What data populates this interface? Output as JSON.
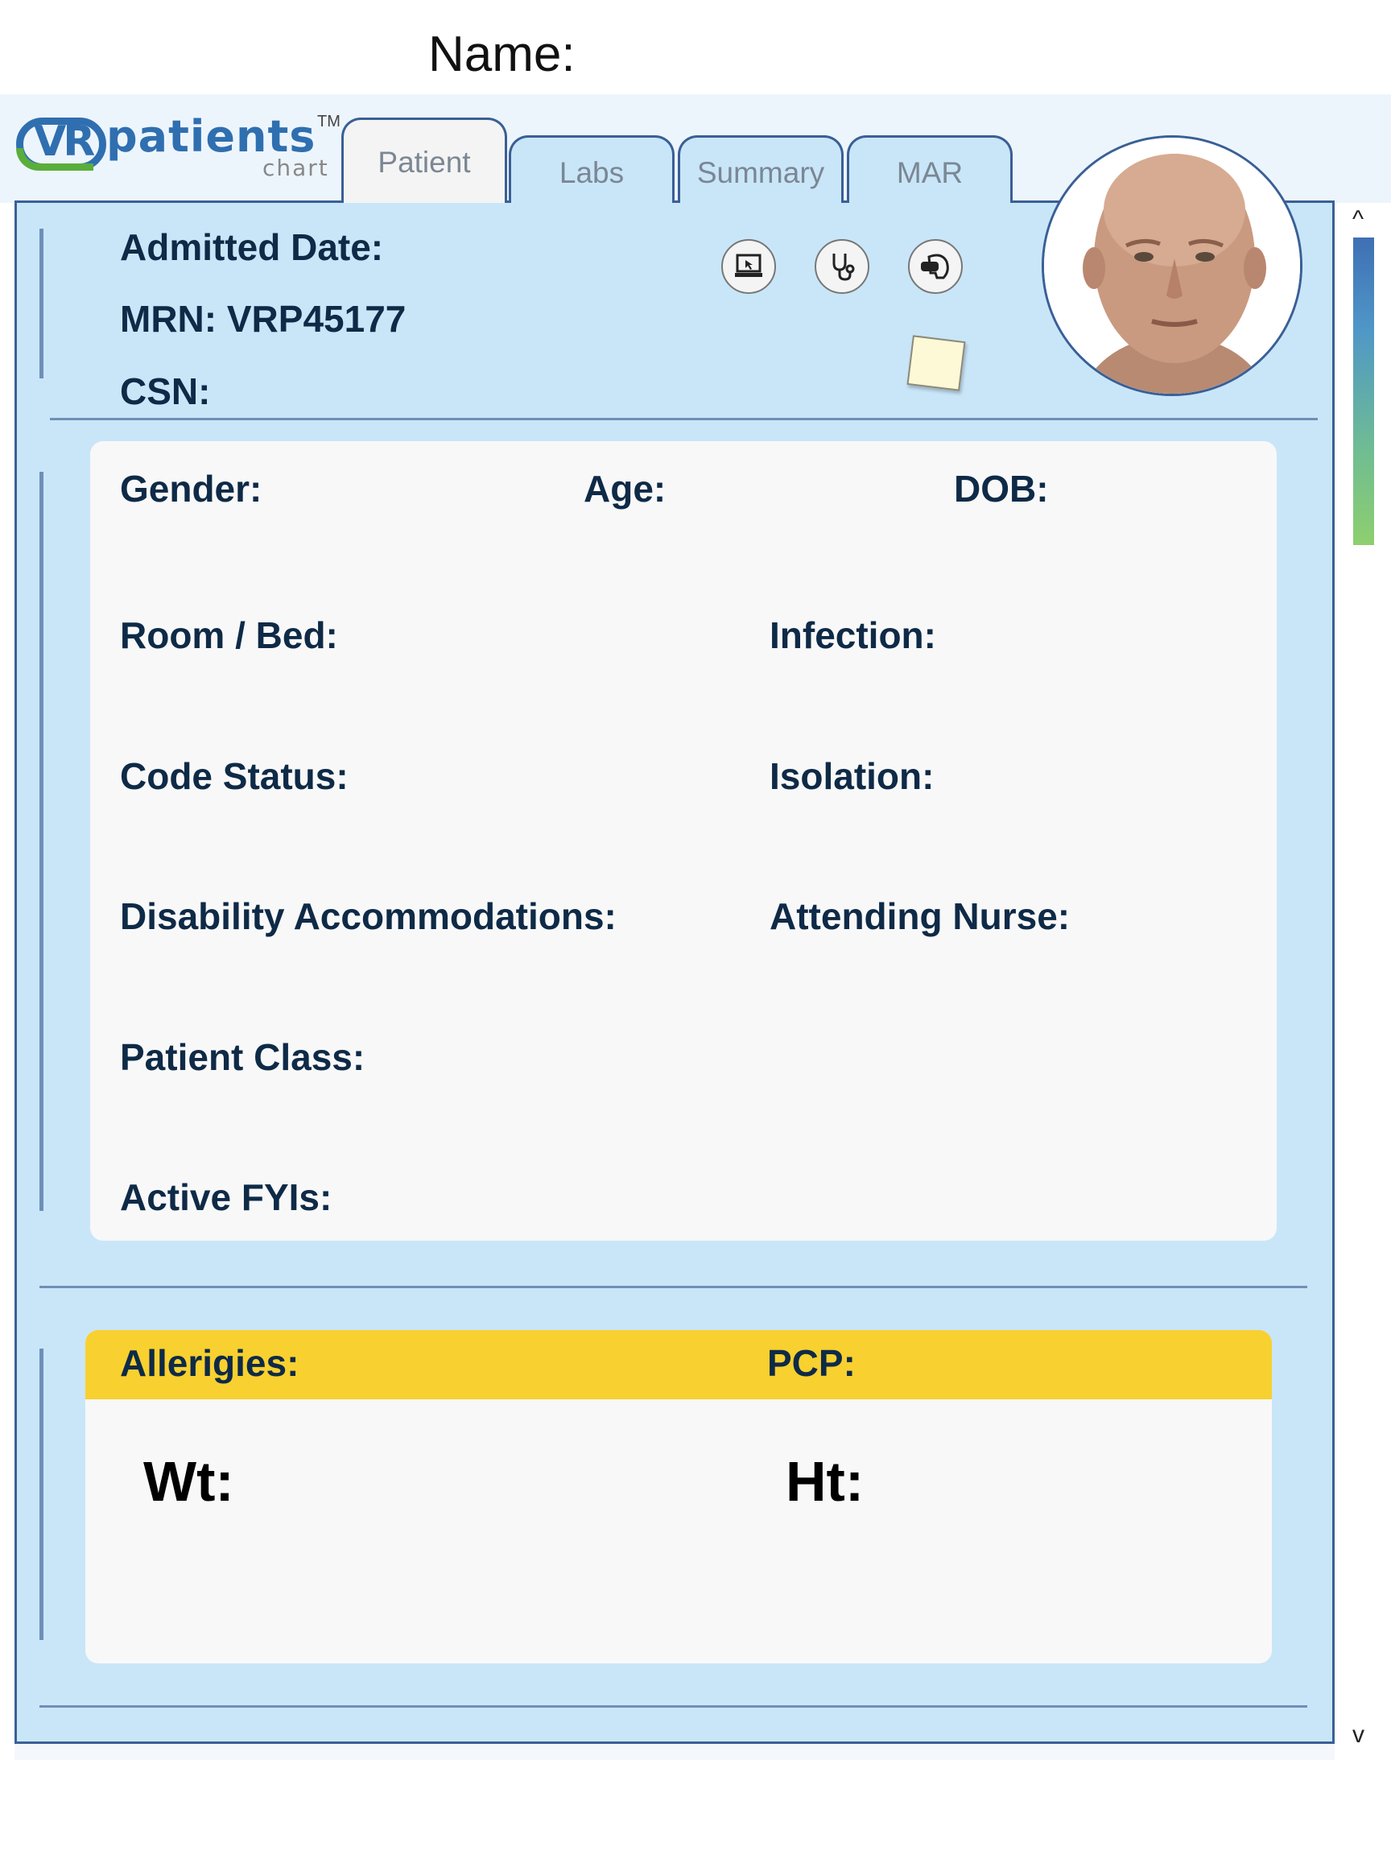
{
  "header": {
    "name_label": "Name:"
  },
  "logo": {
    "vr": "VR",
    "patients": "patients",
    "tm": "TM",
    "chart": "chart"
  },
  "tabs": [
    {
      "label": "Patient",
      "active": true
    },
    {
      "label": "Labs",
      "active": false
    },
    {
      "label": "Summary",
      "active": false
    },
    {
      "label": "MAR",
      "active": false
    }
  ],
  "patient_header": {
    "admitted_date": "Admitted Date:",
    "mrn": "MRN: VRP45177",
    "csn": "CSN:"
  },
  "toolbar": {
    "icons": [
      "computer-icon",
      "stethoscope-icon",
      "vr-headset-icon"
    ],
    "note_icon": "sticky-note-icon"
  },
  "demographics": {
    "gender": "Gender:",
    "age": "Age:",
    "dob": "DOB:",
    "room_bed": "Room / Bed:",
    "infection": "Infection:",
    "code_status": "Code Status:",
    "isolation": "Isolation:",
    "disability": "Disability Accommodations:",
    "attending_nurse": "Attending Nurse:",
    "patient_class": "Patient Class:",
    "active_fyis": "Active FYIs:"
  },
  "allergies_section": {
    "allergies": "Allerigies:",
    "pcp": "PCP:",
    "wt": "Wt:",
    "ht": "Ht:"
  },
  "scrollbar": {
    "up": "^",
    "down": "v"
  },
  "colors": {
    "panel_bg": "#c9e6f9",
    "panel_border": "#3a5f96",
    "label_text": "#0e2a47",
    "allergy_bar": "#f8d030",
    "brand_blue": "#2f6fb0",
    "brand_green": "#5aae3c"
  }
}
